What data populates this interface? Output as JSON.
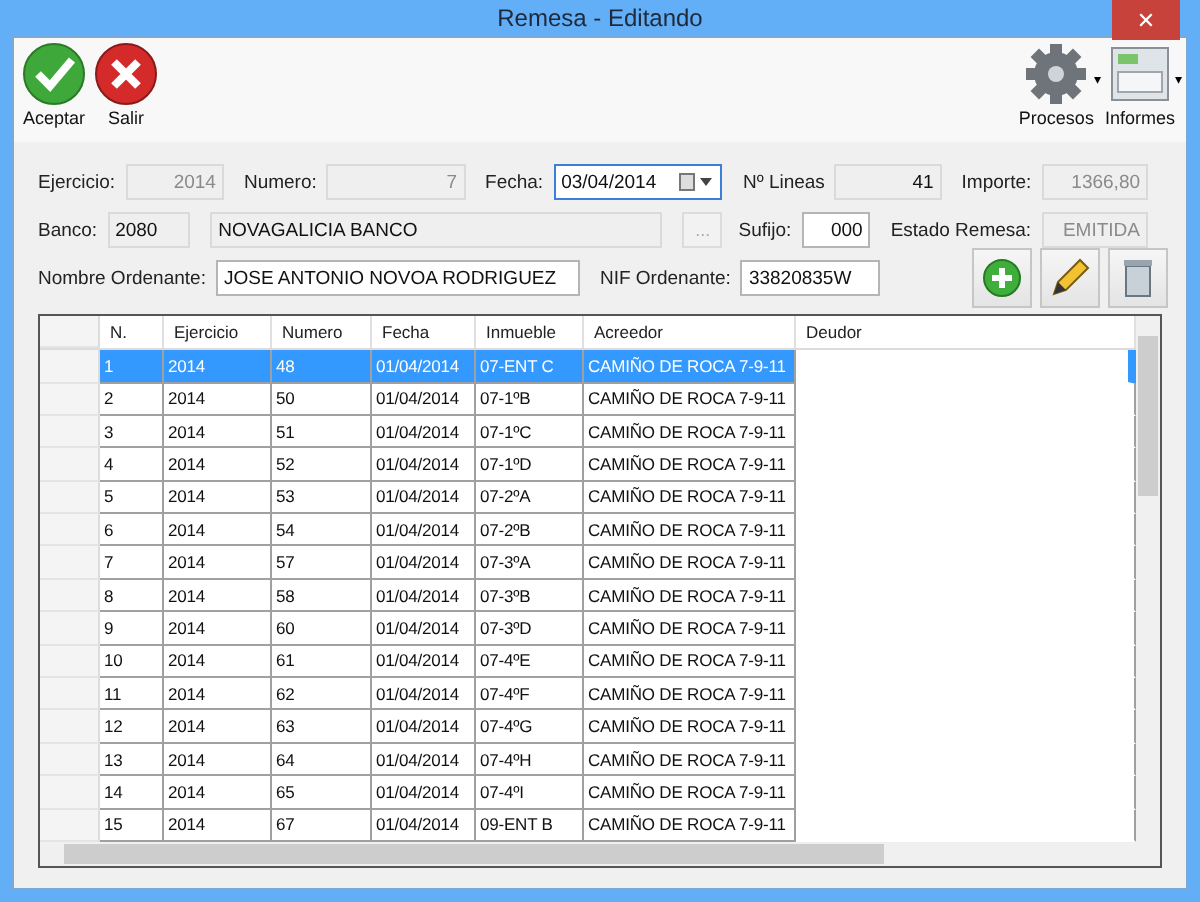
{
  "window": {
    "title": "Remesa - Editando",
    "close": "✕"
  },
  "toolbar": {
    "left": [
      {
        "label": "Aceptar",
        "kind": "accept"
      },
      {
        "label": "Salir",
        "kind": "exit"
      }
    ],
    "right": [
      {
        "label": "Procesos",
        "kind": "gear",
        "caret": "▾"
      },
      {
        "label": "Informes",
        "kind": "printer",
        "caret": "▾"
      }
    ]
  },
  "form": {
    "fields": [
      {
        "label": "Ejercicio:",
        "value": "2014",
        "disabled": true,
        "readonly": true
      },
      {
        "label": "Numero:",
        "value": "7",
        "disabled": true,
        "readonly": true
      },
      {
        "label": "Fecha:",
        "value": "03/04/2014",
        "kind": "date",
        "focused": true
      },
      {
        "label": "Nº Lineas",
        "value": "41",
        "disabled": false,
        "readonly": true
      },
      {
        "label": "Importe:",
        "value": "1366,80",
        "disabled": true,
        "readonly": true
      },
      {
        "label": "Banco:",
        "value": "2080",
        "disabled": false,
        "readonly": true
      },
      {
        "value": "NOVAGALICIA BANCO",
        "disabled": false,
        "readonly": true
      },
      {
        "kind": "ellipsis",
        "value": "...",
        "disabled": true
      },
      {
        "label": "Sufijo:",
        "value": "000",
        "disabled": false,
        "readonly": false
      },
      {
        "label": "Estado Remesa:",
        "value": "EMITIDA",
        "disabled": true,
        "readonly": true
      },
      {
        "label": "Nombre Ordenante:",
        "value": "JOSE ANTONIO NOVOA RODRIGUEZ",
        "disabled": false,
        "readonly": false
      },
      {
        "label": "NIF Ordenante:",
        "value": "33820835W",
        "disabled": false,
        "readonly": false
      }
    ],
    "actions": [
      {
        "kind": "add"
      },
      {
        "kind": "edit"
      },
      {
        "kind": "delete"
      }
    ]
  },
  "table": {
    "columns": [
      "N.",
      "Ejercicio",
      "Numero",
      "Fecha",
      "Inmueble",
      "Acreedor",
      "Deudor"
    ],
    "rows": [
      {
        "selected": true,
        "cells": [
          "1",
          "2014",
          "48",
          "01/04/2014",
          "07-ENT C",
          "CAMIÑO DE ROCA 7-9-11"
        ]
      },
      {
        "selected": false,
        "cells": [
          "2",
          "2014",
          "50",
          "01/04/2014",
          "07-1ºB",
          "CAMIÑO DE ROCA 7-9-11"
        ]
      },
      {
        "selected": false,
        "cells": [
          "3",
          "2014",
          "51",
          "01/04/2014",
          "07-1ºC",
          "CAMIÑO DE ROCA 7-9-11"
        ]
      },
      {
        "selected": false,
        "cells": [
          "4",
          "2014",
          "52",
          "01/04/2014",
          "07-1ºD",
          "CAMIÑO DE ROCA 7-9-11"
        ]
      },
      {
        "selected": false,
        "cells": [
          "5",
          "2014",
          "53",
          "01/04/2014",
          "07-2ºA",
          "CAMIÑO DE ROCA 7-9-11"
        ]
      },
      {
        "selected": false,
        "cells": [
          "6",
          "2014",
          "54",
          "01/04/2014",
          "07-2ºB",
          "CAMIÑO DE ROCA 7-9-11"
        ]
      },
      {
        "selected": false,
        "cells": [
          "7",
          "2014",
          "57",
          "01/04/2014",
          "07-3ºA",
          "CAMIÑO DE ROCA 7-9-11"
        ]
      },
      {
        "selected": false,
        "cells": [
          "8",
          "2014",
          "58",
          "01/04/2014",
          "07-3ºB",
          "CAMIÑO DE ROCA 7-9-11"
        ]
      },
      {
        "selected": false,
        "cells": [
          "9",
          "2014",
          "60",
          "01/04/2014",
          "07-3ºD",
          "CAMIÑO DE ROCA 7-9-11"
        ]
      },
      {
        "selected": false,
        "cells": [
          "10",
          "2014",
          "61",
          "01/04/2014",
          "07-4ºE",
          "CAMIÑO DE ROCA 7-9-11"
        ]
      },
      {
        "selected": false,
        "cells": [
          "11",
          "2014",
          "62",
          "01/04/2014",
          "07-4ºF",
          "CAMIÑO DE ROCA 7-9-11"
        ]
      },
      {
        "selected": false,
        "cells": [
          "12",
          "2014",
          "63",
          "01/04/2014",
          "07-4ºG",
          "CAMIÑO DE ROCA 7-9-11"
        ]
      },
      {
        "selected": false,
        "cells": [
          "13",
          "2014",
          "64",
          "01/04/2014",
          "07-4ºH",
          "CAMIÑO DE ROCA 7-9-11"
        ]
      },
      {
        "selected": false,
        "cells": [
          "14",
          "2014",
          "65",
          "01/04/2014",
          "07-4ºI",
          "CAMIÑO DE ROCA 7-9-11"
        ]
      },
      {
        "selected": false,
        "cells": [
          "15",
          "2014",
          "67",
          "01/04/2014",
          "09-ENT B",
          "CAMIÑO DE ROCA 7-9-11"
        ]
      }
    ]
  }
}
